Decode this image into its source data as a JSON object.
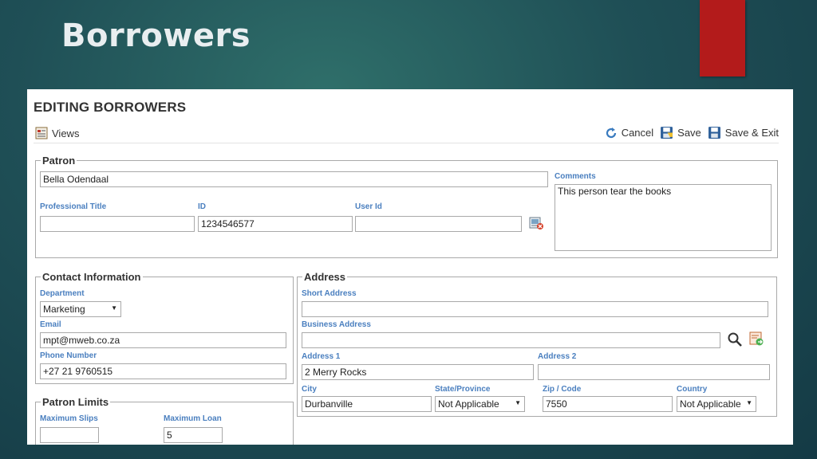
{
  "slide": {
    "title": "Borrowers"
  },
  "page": {
    "heading": "EDITING BORROWERS"
  },
  "toolbar": {
    "views_label": "Views",
    "cancel_label": "Cancel",
    "save_label": "Save",
    "save_exit_label": "Save & Exit"
  },
  "patron": {
    "legend": "Patron",
    "name": "Bella Odendaal",
    "professional_title_label": "Professional Title",
    "professional_title": "",
    "id_label": "ID",
    "id": "1234546577",
    "user_id_label": "User Id",
    "user_id": "",
    "comments_label": "Comments",
    "comments": "This person tear the books"
  },
  "contact": {
    "legend": "Contact Information",
    "department_label": "Department",
    "department": "Marketing",
    "email_label": "Email",
    "email": "mpt@mweb.co.za",
    "phone_label": "Phone Number",
    "phone": "+27 21 9760515"
  },
  "limits": {
    "legend": "Patron Limits",
    "max_slips_label": "Maximum Slips",
    "max_slips": "",
    "max_loan_label": "Maximum Loan",
    "max_loan": "5"
  },
  "address": {
    "legend": "Address",
    "short_label": "Short Address",
    "short": "",
    "business_label": "Business Address",
    "business": "",
    "address1_label": "Address 1",
    "address1": "2 Merry Rocks",
    "address2_label": "Address 2",
    "address2": "",
    "city_label": "City",
    "city": "Durbanville",
    "state_label": "State/Province",
    "state": "Not Applicable",
    "zip_label": "Zip / Code",
    "zip": "7550",
    "country_label": "Country",
    "country": "Not Applicable"
  },
  "colors": {
    "accent_red": "#b31b1b",
    "label_blue": "#4a7fbf",
    "background_teal": "#1f4f56"
  }
}
